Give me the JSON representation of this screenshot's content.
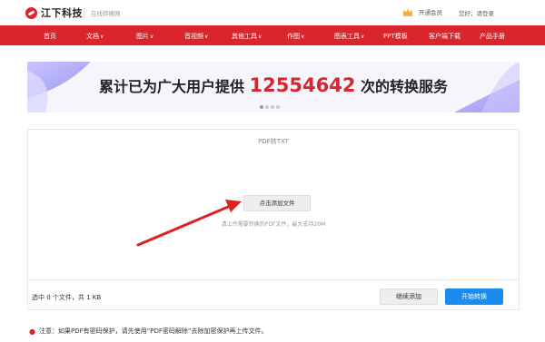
{
  "header": {
    "logo_text": "江下科技",
    "tagline": "在线转换网",
    "vip_label": "开通会员",
    "login_text": "您好，请登录"
  },
  "nav": {
    "items": [
      {
        "label": "首页",
        "chevron": ""
      },
      {
        "label": "文档",
        "chevron": "∨"
      },
      {
        "label": "图片",
        "chevron": "∨"
      },
      {
        "label": "音视频",
        "chevron": "∨"
      },
      {
        "label": "其他工具",
        "chevron": "∨"
      },
      {
        "label": "作图",
        "chevron": "∨"
      },
      {
        "label": "图表工具",
        "chevron": "∨"
      },
      {
        "label": "PPT模板",
        "chevron": ""
      },
      {
        "label": "客户端下载",
        "chevron": ""
      },
      {
        "label": "产品手册",
        "chevron": ""
      }
    ]
  },
  "banner": {
    "text_before": "累计已为广大用户提供 ",
    "number": "12554642",
    "text_after": " 次的转换服务"
  },
  "converter": {
    "title": "PDF转TXT",
    "add_file_label": "点击添加文件",
    "hint": "请上传需要转换的PDF文件，最大支持20M",
    "selection_info": "选中 0 个文件，共 1 KB",
    "continue_label": "继续添加",
    "start_label": "开始转换"
  },
  "notice": {
    "text": "注意：如果PDF有密码保护，请先使用“PDF密码解除”去除加密保护再上传文件。"
  },
  "colors": {
    "brand_red": "#d9252b",
    "primary_blue": "#1a8cf0",
    "arrow_red": "#e02020"
  }
}
